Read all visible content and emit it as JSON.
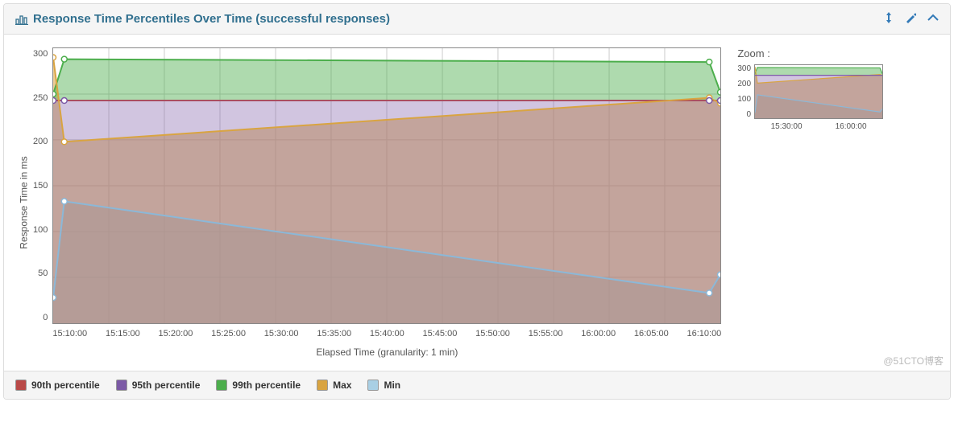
{
  "header": {
    "title": "Response Time Percentiles Over Time (successful responses)"
  },
  "axes": {
    "ylabel": "Response Time in ms",
    "xlabel": "Elapsed Time (granularity: 1 min)",
    "yticks": [
      "300",
      "250",
      "200",
      "150",
      "100",
      "50",
      "0"
    ],
    "xticks": [
      "15:10:00",
      "15:15:00",
      "15:20:00",
      "15:25:00",
      "15:30:00",
      "15:35:00",
      "15:40:00",
      "15:45:00",
      "15:50:00",
      "15:55:00",
      "16:00:00",
      "16:05:00",
      "16:10:00"
    ]
  },
  "zoom": {
    "title": "Zoom :",
    "yticks": [
      "300",
      "200",
      "100",
      "0"
    ],
    "xticks": [
      "15:30:00",
      "16:00:00"
    ]
  },
  "legend": [
    {
      "label": "90th percentile",
      "color": "#b94a48"
    },
    {
      "label": "95th percentile",
      "color": "#7c5aa6"
    },
    {
      "label": "99th percentile",
      "color": "#4cae4c"
    },
    {
      "label": "Max",
      "color": "#d9a441"
    },
    {
      "label": "Min",
      "color": "#a9cfe4"
    }
  ],
  "watermark": "@51CTO博客",
  "chart_data": {
    "type": "line",
    "title": "Response Time Percentiles Over Time (successful responses)",
    "xlabel": "Elapsed Time (granularity: 1 min)",
    "ylabel": "Response Time in ms",
    "ylim": [
      0,
      300
    ],
    "x": [
      "15:10:00",
      "15:11:00",
      "16:09:00",
      "16:10:00"
    ],
    "series": [
      {
        "name": "90th percentile",
        "color": "#b94a48",
        "values": [
          243,
          243,
          243,
          243
        ]
      },
      {
        "name": "95th percentile",
        "color": "#7c5aa6",
        "values": [
          243,
          243,
          243,
          243
        ]
      },
      {
        "name": "99th percentile",
        "color": "#4cae4c",
        "values": [
          250,
          288,
          285,
          252
        ]
      },
      {
        "name": "Max",
        "color": "#d9a441",
        "values": [
          250,
          288,
          285,
          252
        ]
      },
      {
        "name": "Min",
        "color": "#a9cfe4",
        "values": [
          28,
          133,
          33,
          53
        ]
      }
    ],
    "mean_line": {
      "color": "#d9a441",
      "values": [
        290,
        198,
        246,
        240
      ]
    }
  }
}
